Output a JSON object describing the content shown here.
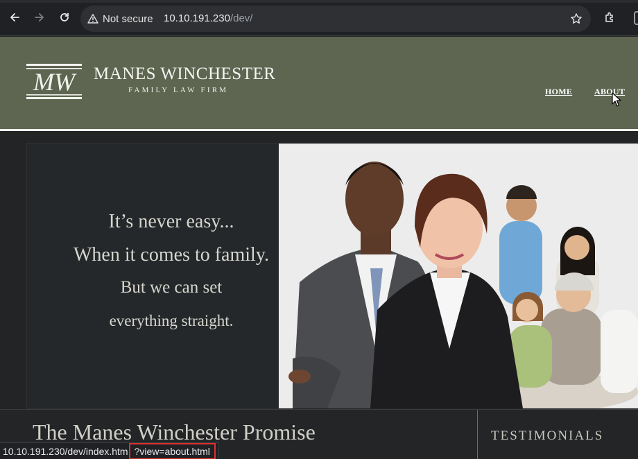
{
  "browser": {
    "security_label": "Not secure",
    "url_host": "10.10.191.230",
    "url_path": "/dev/",
    "status_url_base": "10.10.191.230/dev/index.htm",
    "status_url_query": "?view=about.html"
  },
  "site": {
    "brand_name": "MANES WINCHESTER",
    "brand_tagline": "FAMILY LAW FIRM",
    "logo_text": "MW",
    "nav": [
      {
        "label": "HOME"
      },
      {
        "label": "ABOUT"
      }
    ],
    "hero_lines": [
      "It’s never easy...",
      "When it comes to family.",
      "But we can set",
      "everything straight."
    ],
    "promise_title": "The Manes Winchester Promise",
    "testimonials_label": "TESTIMONIALS"
  },
  "colors": {
    "header_bg": "#5e6651",
    "page_bg": "#222425",
    "status_highlight": "#e03030"
  },
  "icons": [
    "back-arrow-icon",
    "forward-arrow-icon",
    "reload-icon",
    "warning-icon",
    "star-icon",
    "extensions-icon",
    "mouse-cursor-icon"
  ]
}
